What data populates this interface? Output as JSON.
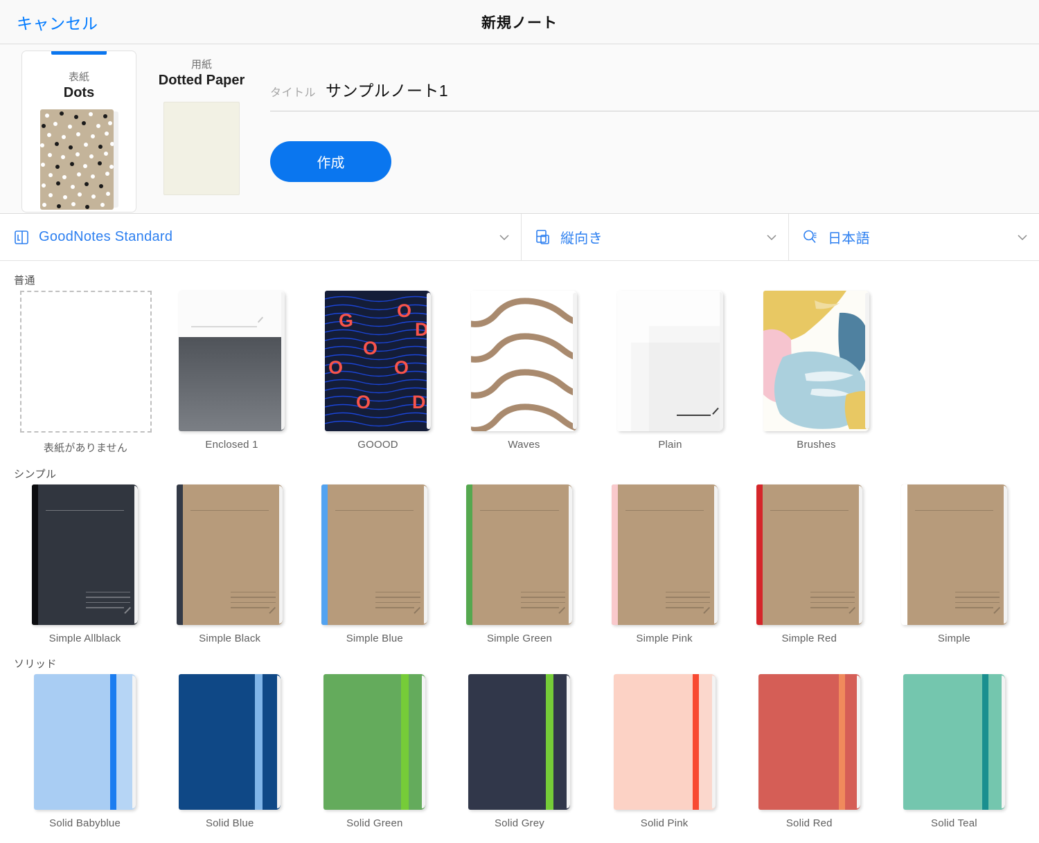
{
  "navbar": {
    "cancel_label": "キャンセル",
    "title": "新規ノート"
  },
  "selection": {
    "cover": {
      "kind_label": "表紙",
      "name": "Dots",
      "selected": true
    },
    "paper": {
      "kind_label": "用紙",
      "name": "Dotted Paper"
    },
    "title_field": {
      "label": "タイトル",
      "value": "サンプルノート1"
    },
    "create_button": "作成"
  },
  "optionbar": [
    {
      "icon": "notebook-icon",
      "label": "GoodNotes Standard",
      "chevron": "chevron-down-icon"
    },
    {
      "icon": "orientation-portrait-icon",
      "label": "縦向き",
      "chevron": "chevron-down-icon"
    },
    {
      "icon": "language-search-icon",
      "label": "日本語",
      "chevron": "chevron-down-icon"
    }
  ],
  "gallery": {
    "sections": [
      {
        "title": "普通",
        "items": [
          {
            "label": "表紙がありません",
            "style": "empty"
          },
          {
            "label": "Enclosed 1",
            "style": "enclosed"
          },
          {
            "label": "GOOOD",
            "style": "goood"
          },
          {
            "label": "Waves",
            "style": "waves"
          },
          {
            "label": "Plain",
            "style": "plain"
          },
          {
            "label": "Brushes",
            "style": "brushes"
          }
        ]
      },
      {
        "title": "シンプル",
        "items": [
          {
            "label": "Simple Allblack",
            "style": "simple",
            "body": "#31363f",
            "spine": "#0c0d10"
          },
          {
            "label": "Simple Black",
            "style": "simple",
            "body": "#b79b7b",
            "spine": "#333a47"
          },
          {
            "label": "Simple Blue",
            "style": "simple",
            "body": "#b79b7b",
            "spine": "#53a3f0"
          },
          {
            "label": "Simple Green",
            "style": "simple",
            "body": "#b79b7b",
            "spine": "#55a84f"
          },
          {
            "label": "Simple Pink",
            "style": "simple",
            "body": "#b79b7b",
            "spine": "#f9c9cc"
          },
          {
            "label": "Simple Red",
            "style": "simple",
            "body": "#b79b7b",
            "spine": "#d5262a"
          },
          {
            "label": "Simple",
            "style": "simple",
            "body": "#b79b7b",
            "spine": "#ffffff"
          }
        ]
      },
      {
        "title": "ソリッド",
        "items": [
          {
            "label": "Solid Babyblue",
            "style": "solid",
            "body": "#a9cdf3",
            "strap": "#1b7df0",
            "right": "#a9cdf3"
          },
          {
            "label": "Solid Blue",
            "style": "solid",
            "body": "#0f4886",
            "strap": "#80b5e8",
            "right": "#0f4886"
          },
          {
            "label": "Solid Green",
            "style": "solid",
            "body": "#64ab5c",
            "strap": "#76cc38",
            "right": "#64ab5c"
          },
          {
            "label": "Solid Grey",
            "style": "solid",
            "body": "#31374a",
            "strap": "#76cc38",
            "right": "#31374a"
          },
          {
            "label": "Solid Pink",
            "style": "solid",
            "body": "#fcd2c5",
            "strap": "#f84a32",
            "right": "#fcd2c5"
          },
          {
            "label": "Solid Red",
            "style": "solid",
            "body": "#d55e56",
            "strap": "#f08a5c",
            "right": "#d55e56"
          },
          {
            "label": "Solid Teal",
            "style": "solid",
            "body": "#74c6ae",
            "strap": "#1a8f8f",
            "right": "#74c6ae"
          }
        ]
      }
    ]
  },
  "colors": {
    "accent_blue": "#0a76ef",
    "link_blue": "#007aff",
    "dots_cover_bg": "#c4b49a",
    "paper_bg": "#f2f1e4"
  },
  "chart_data": null
}
